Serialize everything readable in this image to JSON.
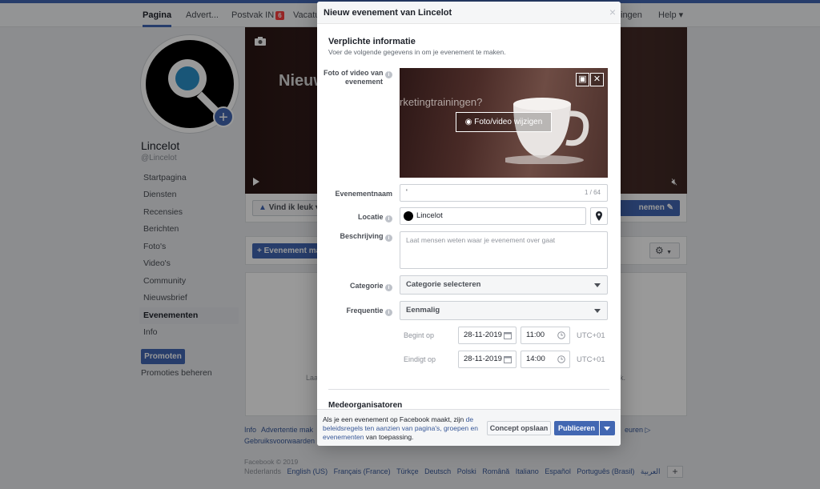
{
  "colors": {
    "brand": "#4267b2",
    "link": "#385898",
    "badge": "#fa3e3e"
  },
  "nav": {
    "items": [
      {
        "label": "Pagina"
      },
      {
        "label": "Advert..."
      },
      {
        "label": "Postvak IN",
        "badge": "6"
      },
      {
        "label": "Vacatu"
      },
      {
        "label": "ingen"
      },
      {
        "label": "Help ▾"
      }
    ]
  },
  "page": {
    "name": "Lincelot",
    "handle": "@Lincelot",
    "sidebar": [
      {
        "label": "Startpagina"
      },
      {
        "label": "Diensten"
      },
      {
        "label": "Recensies"
      },
      {
        "label": "Berichten"
      },
      {
        "label": "Foto's"
      },
      {
        "label": "Video's"
      },
      {
        "label": "Community"
      },
      {
        "label": "Nieuwsbrief"
      },
      {
        "label": "Evenementen"
      },
      {
        "label": "Info"
      }
    ],
    "promote_label": "Promoten",
    "promotions_label": "Promoties beheren",
    "like_label": "Vind ik leuk ▾",
    "edit_label": "nemen",
    "create_event_label": "+ Evenement mak",
    "cover_text": "Nieuw",
    "events_frag_left": "Laa",
    "events_frag_right": "k."
  },
  "footer": {
    "links": [
      "Info",
      "Advertentie mak"
    ],
    "line2": "Gebruiksvoorwaarden",
    "tail": "euren",
    "copyright": "Facebook © 2019",
    "languages": [
      "Nederlands",
      "English (US)",
      "Français (France)",
      "Türkçe",
      "Deutsch",
      "Polski",
      "Română",
      "Italiano",
      "Español",
      "Português (Brasil)",
      "العربية"
    ],
    "lang_add": "+"
  },
  "modal": {
    "title": "Nieuw evenement van Lincelot",
    "close": "×",
    "section_title": "Verplichte informatie",
    "section_sub": "Voer de volgende gegevens in om je evenement te maken.",
    "photo_label": "Foto of video van evenement",
    "photo_label_1": "Foto of video van",
    "photo_label_2": "evenement",
    "photo_overlay_text": "rketingtrainingen?",
    "photo_button": "Foto/video wijzigen",
    "name_label": "Evenementnaam",
    "name_value": "'",
    "name_count": "1 / 64",
    "location_label": "Locatie",
    "location_value": "Lincelot",
    "description_label": "Beschrijving",
    "description_placeholder": "Laat mensen weten waar je evenement over gaat",
    "category_label": "Categorie",
    "category_value": "Categorie selecteren",
    "frequency_label": "Frequentie",
    "frequency_value": "Eenmalig",
    "start_label": "Begint op",
    "start_date": "28-11-2019",
    "start_time": "11:00",
    "start_tz": "UTC+01",
    "end_label": "Eindigt op",
    "end_date": "28-11-2019",
    "end_time": "14:00",
    "end_tz": "UTC+01",
    "coorganizers_label": "Medeorganisatoren",
    "legal_1": "Als je een evenement op Facebook maakt, zijn ",
    "legal_link": "de beleidsregels ten aanzien van pagina's, groepen en evenementen",
    "legal_2": " van toepassing.",
    "save_draft": "Concept opslaan",
    "publish": "Publiceren"
  }
}
